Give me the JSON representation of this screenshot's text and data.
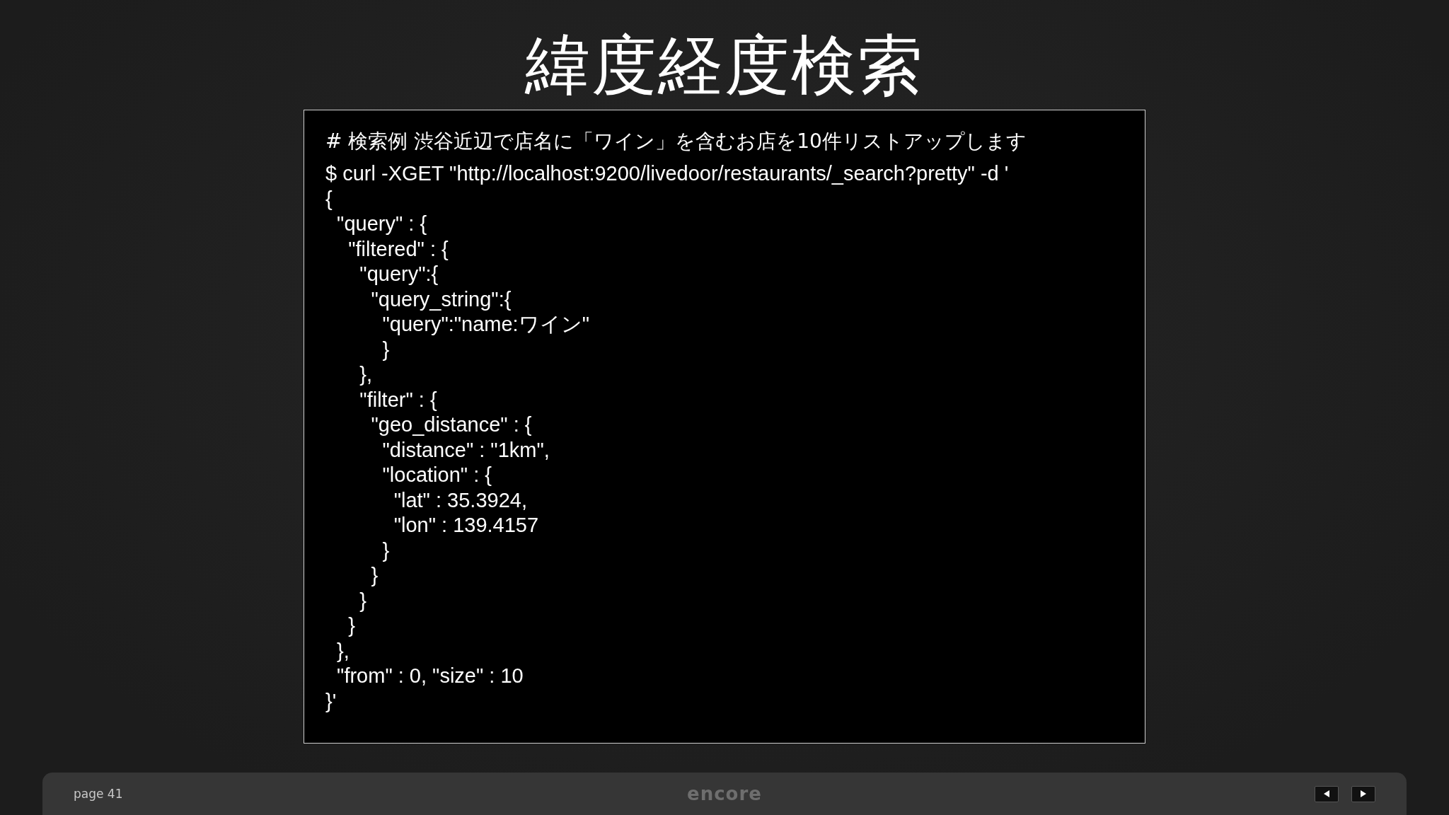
{
  "slide": {
    "title": "緯度経度検索",
    "comment": "# 検索例 渋谷近辺で店名に「ワイン」を含むお店を10件リストアップします",
    "code_lines": [
      "$ curl -XGET \"http://localhost:9200/livedoor/restaurants/_search?pretty\" -d '",
      "{",
      "  \"query\" : {",
      "    \"filtered\" : {",
      "      \"query\":{",
      "        \"query_string\":{",
      "          \"query\":\"name:ワイン\"",
      "          }",
      "      },",
      "      \"filter\" : {",
      "        \"geo_distance\" : {",
      "          \"distance\" : \"1km\",",
      "          \"location\" : {",
      "            \"lat\" : 35.3924,",
      "            \"lon\" : 139.4157",
      "          }",
      "        }",
      "      }",
      "    }",
      "  },",
      "  \"from\" : 0, \"size\" : 10",
      "}'"
    ]
  },
  "footer": {
    "page": "page 41",
    "logo": "encore",
    "buttons": [
      {
        "kind": "prev"
      },
      {
        "kind": "next"
      }
    ]
  }
}
